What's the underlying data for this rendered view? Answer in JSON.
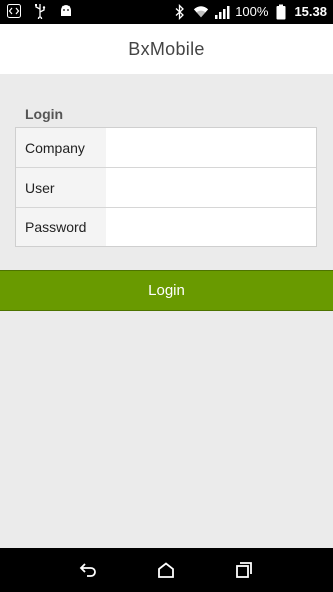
{
  "status_bar": {
    "battery_percent": "100%",
    "time": "15.38",
    "icons_left": [
      "code-icon",
      "usb-icon",
      "android-icon"
    ],
    "icons_right": [
      "bluetooth-icon",
      "wifi-icon",
      "signal-icon",
      "battery-icon"
    ]
  },
  "app_bar": {
    "title": "BxMobile"
  },
  "login_section": {
    "heading": "Login",
    "fields": [
      {
        "label": "Company",
        "value": ""
      },
      {
        "label": "User",
        "value": ""
      },
      {
        "label": "Password",
        "value": ""
      }
    ],
    "button_label": "Login"
  },
  "nav_bar": {
    "buttons": [
      "back-icon",
      "home-icon",
      "recents-icon"
    ]
  },
  "colors": {
    "accent": "#699a00",
    "background": "#ebebeb"
  }
}
